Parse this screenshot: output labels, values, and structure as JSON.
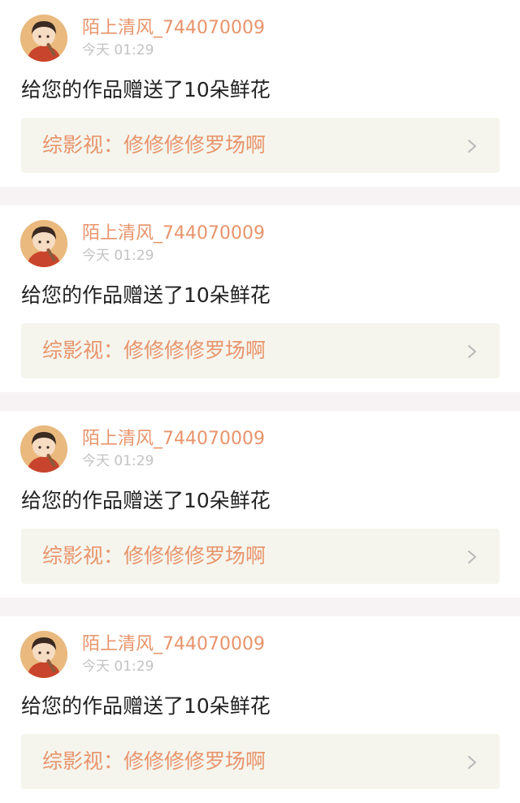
{
  "colors": {
    "accent": "#e8946b",
    "tab_indicator": "#e85d9a",
    "link_background": "#f5f5ee",
    "divider": "#f7f3f5",
    "timestamp": "#c3c3c3",
    "text": "#222222"
  },
  "notifications": [
    {
      "username": "陌上清风_744070009",
      "time": "今天 01:29",
      "message": "给您的作品赠送了10朵鲜花",
      "work_title": "综影视：修修修修罗场啊",
      "avatar_icon": "user-avatar-icon",
      "chevron_icon": "chevron-right-icon"
    },
    {
      "username": "陌上清风_744070009",
      "time": "今天 01:29",
      "message": "给您的作品赠送了10朵鲜花",
      "work_title": "综影视：修修修修罗场啊",
      "avatar_icon": "user-avatar-icon",
      "chevron_icon": "chevron-right-icon"
    },
    {
      "username": "陌上清风_744070009",
      "time": "今天 01:29",
      "message": "给您的作品赠送了10朵鲜花",
      "work_title": "综影视：修修修修罗场啊",
      "avatar_icon": "user-avatar-icon",
      "chevron_icon": "chevron-right-icon"
    },
    {
      "username": "陌上清风_744070009",
      "time": "今天 01:29",
      "message": "给您的作品赠送了10朵鲜花",
      "work_title": "综影视：修修修修罗场啊",
      "avatar_icon": "user-avatar-icon",
      "chevron_icon": "chevron-right-icon"
    }
  ]
}
